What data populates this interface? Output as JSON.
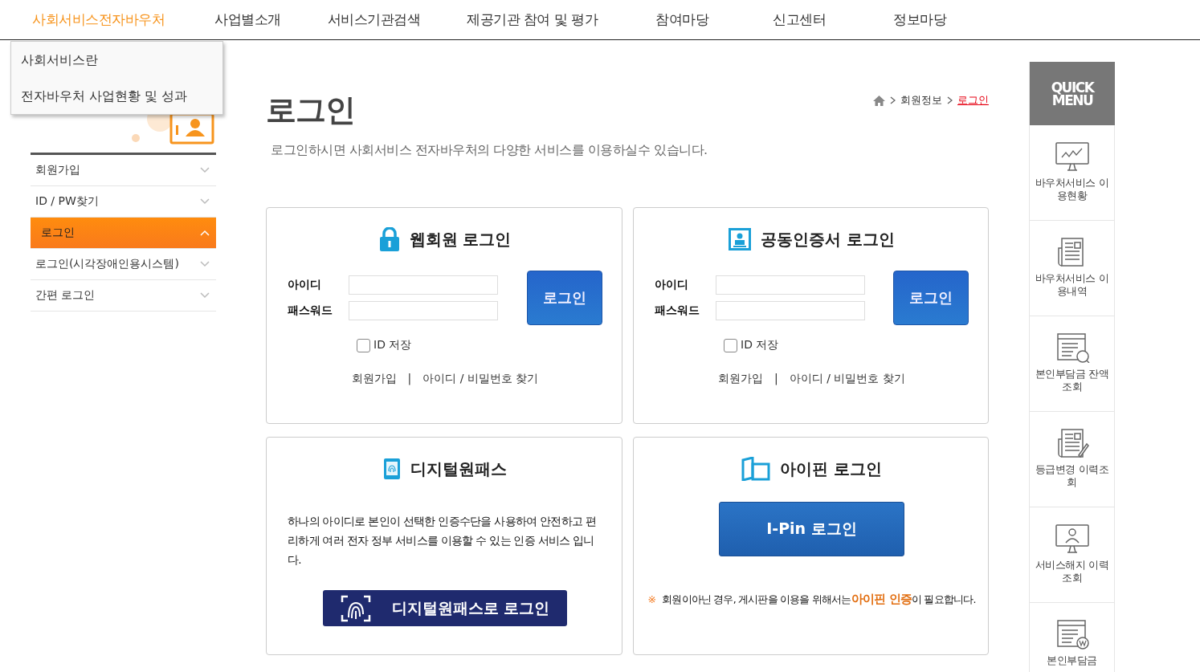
{
  "nav": [
    {
      "label": "사회서비스전자바우처",
      "selected": true
    },
    {
      "label": "사업별소개",
      "selected": false
    },
    {
      "label": "서비스기관검색",
      "selected": false
    },
    {
      "label": "제공기관 참여 및 평가",
      "selected": false
    },
    {
      "label": "참여마당",
      "selected": false
    },
    {
      "label": "신고센터",
      "selected": false
    },
    {
      "label": "정보마당",
      "selected": false
    }
  ],
  "dropdown": [
    "사회서비스란",
    "전자바우처 사업현황 및 성과"
  ],
  "sidebar": {
    "items": [
      {
        "label": "회원가입",
        "selected": false
      },
      {
        "label": "ID / PW찾기",
        "selected": false
      },
      {
        "label": "로그인",
        "selected": true
      },
      {
        "label": "로그인(시각장애인용시스템)",
        "selected": false
      },
      {
        "label": "간편 로그인",
        "selected": false
      }
    ]
  },
  "page": {
    "title": "로그인",
    "subtitle": "로그인하시면 사회서비스 전자바우처의 다양한 서비스를 이용하실수 있습니다.",
    "breadcrumb": [
      "회원정보",
      "로그인"
    ]
  },
  "login_panels": [
    {
      "title": "웹회원 로그인",
      "kind": "lock",
      "id_label": "아이디",
      "pw_label": "패스워드",
      "button": "로그인",
      "save_id": {
        "label": "ID 저장",
        "checked": false
      },
      "links": [
        "회원가입",
        "아이디 / 비밀번호 찾기"
      ],
      "separator": "|"
    },
    {
      "title": "공동인증서 로그인",
      "kind": "cert",
      "id_label": "아이디",
      "pw_label": "패스워드",
      "button": "로그인",
      "save_id": {
        "label": "ID 저장",
        "checked": false
      },
      "links": [
        "회원가입",
        "아이디 / 비밀번호 찾기"
      ],
      "separator": "|"
    }
  ],
  "digital_onepass": {
    "title": "디지털원패스",
    "description": "하나의 아이디로 본인이 선택한 인증수단을 사용하여 안전하고 편리하게 여러 전자 정부 서비스를 이용할 수 있는 인증 서비스 입니다.",
    "button": "디지털원패스로 로그인"
  },
  "ipin": {
    "title": "아이핀 로그인",
    "button": "I-Pin 로그인",
    "note_mark": "※",
    "note": "회원이아닌 경우, 게시판을 이용을 위해서는**아이핀 인증**이 필요합니다."
  },
  "quick_menu": {
    "title": "QUICK MENU",
    "items": [
      {
        "label": "바우처서비스 이용현황",
        "kind": "chart"
      },
      {
        "label": "바우처서비스 이용내역",
        "kind": "news"
      },
      {
        "label": "본인부담금 잔액조회",
        "kind": "search"
      },
      {
        "label": "등급변경 이력조회",
        "kind": "edit"
      },
      {
        "label": "서비스해지 이력조회",
        "kind": "person"
      },
      {
        "label": "본인부담금",
        "kind": "won"
      }
    ]
  }
}
